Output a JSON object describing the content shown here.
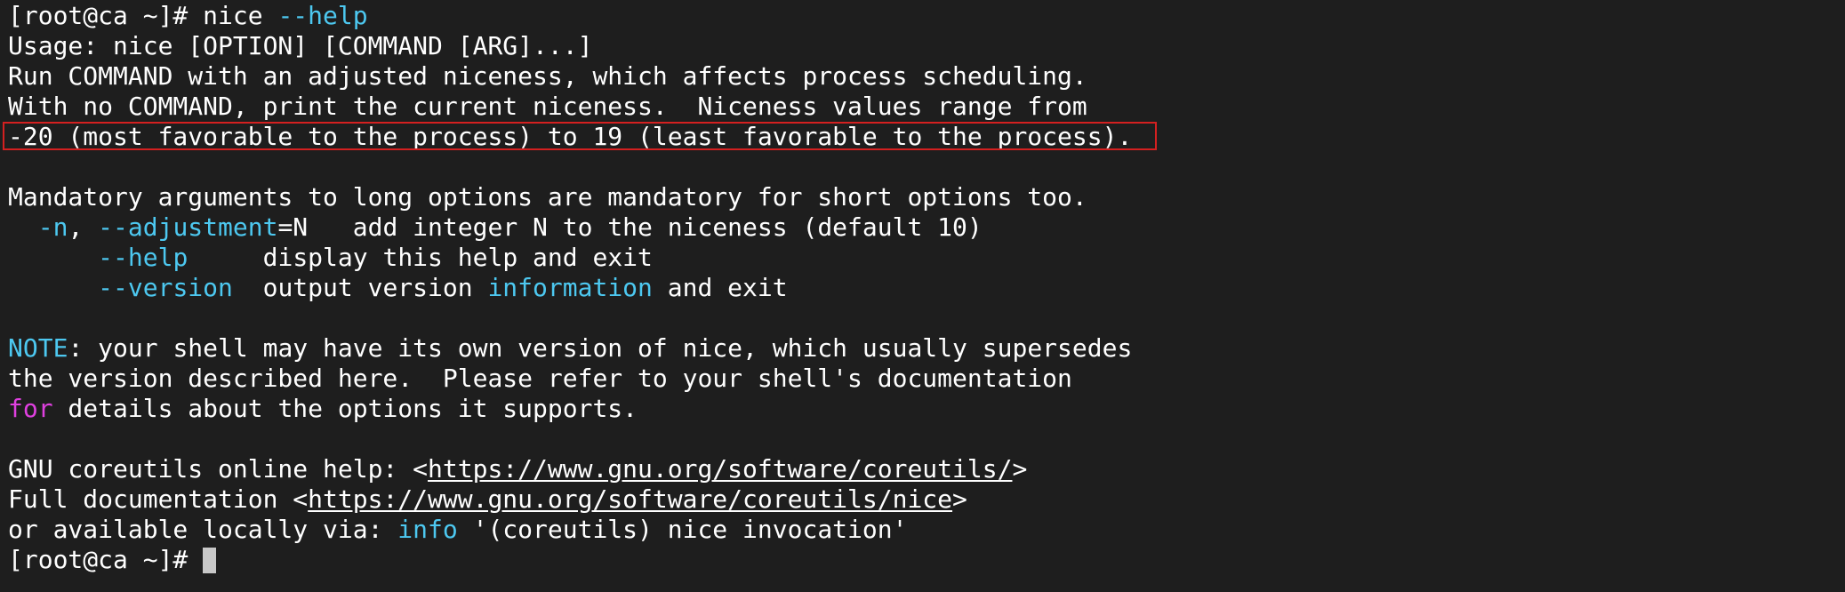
{
  "terminal": {
    "prompt": "[root@ca ~]# ",
    "command": "nice ",
    "command_flag": "--help",
    "usage": "Usage: nice [OPTION] [COMMAND [ARG]...]",
    "desc1": "Run COMMAND with an adjusted niceness, which affects process scheduling.",
    "desc2": "With no COMMAND, print the current niceness.  Niceness values range from",
    "desc3_highlighted": "-20 (most favorable to the process) to 19 (least favorable to the process).",
    "mandatory": "Mandatory arguments to long options are mandatory for short options too.",
    "opt_n": {
      "indent": "  ",
      "short": "-n",
      "sep": ", ",
      "long": "--adjustment",
      "arg": "=N",
      "desc": "   add integer N to the niceness (default 10)"
    },
    "opt_help": {
      "indent": "      ",
      "long": "--help",
      "desc": "     display this help and exit"
    },
    "opt_version": {
      "indent": "      ",
      "long": "--version",
      "desc_pre": "  output version ",
      "desc_hl": "information",
      "desc_post": " and exit"
    },
    "note": {
      "keyword": "NOTE",
      "text1": ": your shell may have its own version of nice, which usually supersedes",
      "text2": "the version described here.  Please refer to your shell's documentation",
      "for_kw": "for",
      "text3": " details about the options it supports."
    },
    "online_help": {
      "pre": "GNU coreutils online help: <",
      "url": "https://www.gnu.org/software/coreutils/",
      "post": ">"
    },
    "full_doc": {
      "pre": "Full documentation <",
      "url": "https://www.gnu.org/software/coreutils/nice",
      "post": ">"
    },
    "local": {
      "pre": "or available locally via: ",
      "info_kw": "info",
      "post": " '(coreutils) nice invocation'"
    },
    "final_prompt": "[root@ca ~]# "
  },
  "colors": {
    "background": "#1e1e1e",
    "text": "#ffffff",
    "keyword_cyan": "#4dc8f0",
    "keyword_magenta": "#e040e0",
    "highlight_border": "#d42020",
    "cursor": "#c8c8c8"
  }
}
